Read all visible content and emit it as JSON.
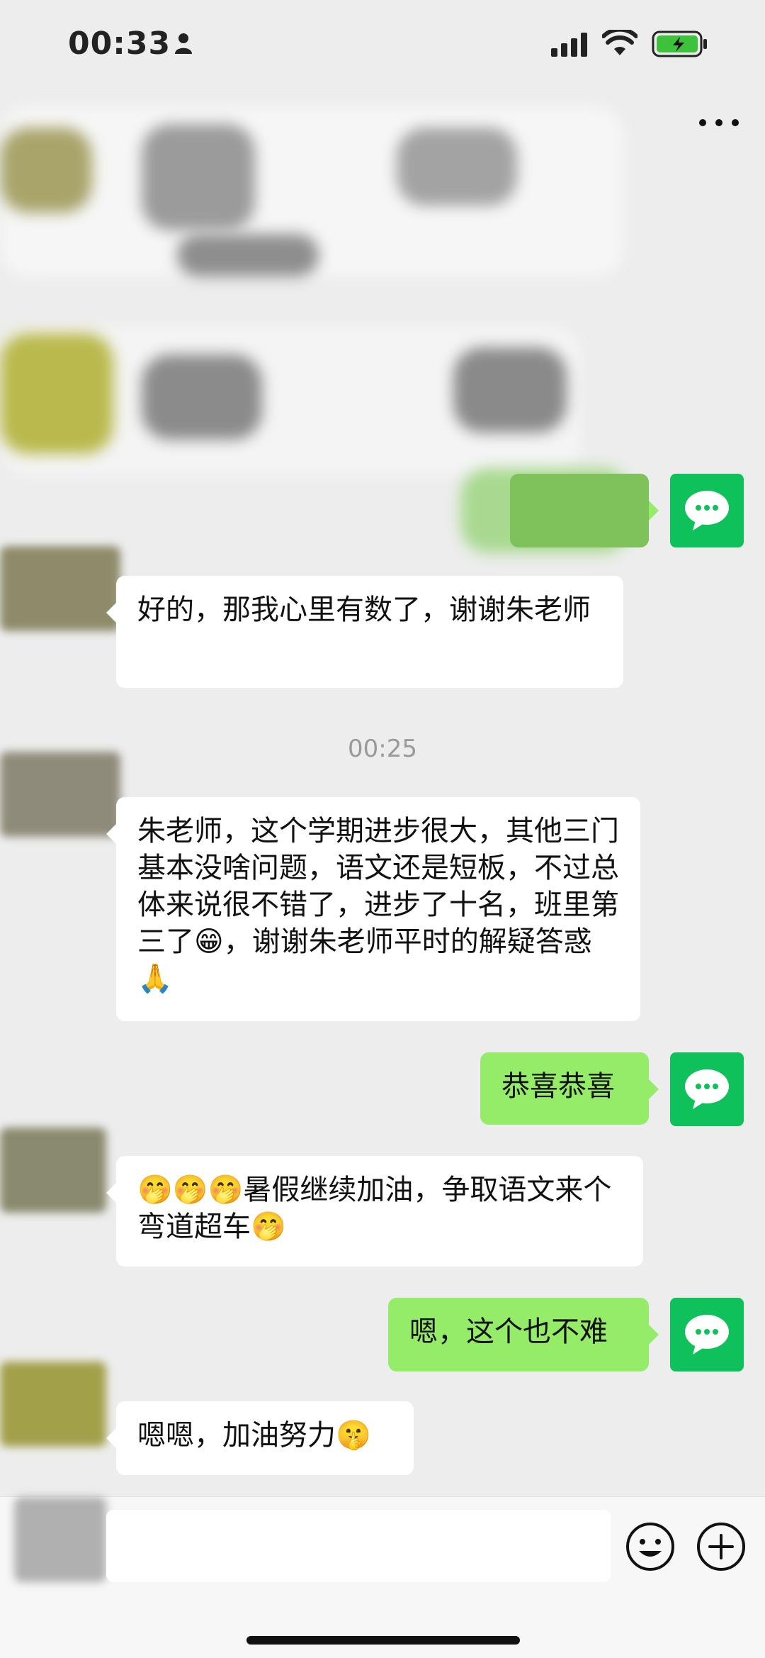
{
  "status_bar": {
    "time": "00:33"
  },
  "chat": {
    "messages": [
      {
        "side": "right",
        "text": ""
      },
      {
        "side": "left",
        "text": "好的，那我心里有数了，谢谢朱老师"
      },
      {
        "type": "timestamp",
        "text": "00:25"
      },
      {
        "side": "left",
        "text": "朱老师，这个学期进步很大，其他三门基本没啥问题，语文还是短板，不过总体来说很不错了，进步了十名，班里第三了😁，谢谢朱老师平时的解疑答惑🙏"
      },
      {
        "side": "right",
        "text": "恭喜恭喜"
      },
      {
        "side": "left",
        "text": "🤭🤭🤭暑假继续加油，争取语文来个弯道超车🤭"
      },
      {
        "side": "right",
        "text": "嗯，这个也不难"
      },
      {
        "side": "left",
        "text": "嗯嗯，加油努力🤫"
      }
    ]
  },
  "input_bar": {
    "placeholder": ""
  },
  "icons": {
    "status": [
      "person-icon",
      "signal-icon",
      "wifi-icon",
      "battery-icon"
    ],
    "input": [
      "emoji-icon",
      "plus-icon"
    ],
    "self_avatar": "wechat-bubble-icon",
    "header": "more-icon"
  },
  "colors": {
    "background": "#ededed",
    "incoming_bubble": "#ffffff",
    "outgoing_bubble": "#95ec69",
    "self_avatar": "#0fc15a",
    "battery": "#3ec13b"
  }
}
